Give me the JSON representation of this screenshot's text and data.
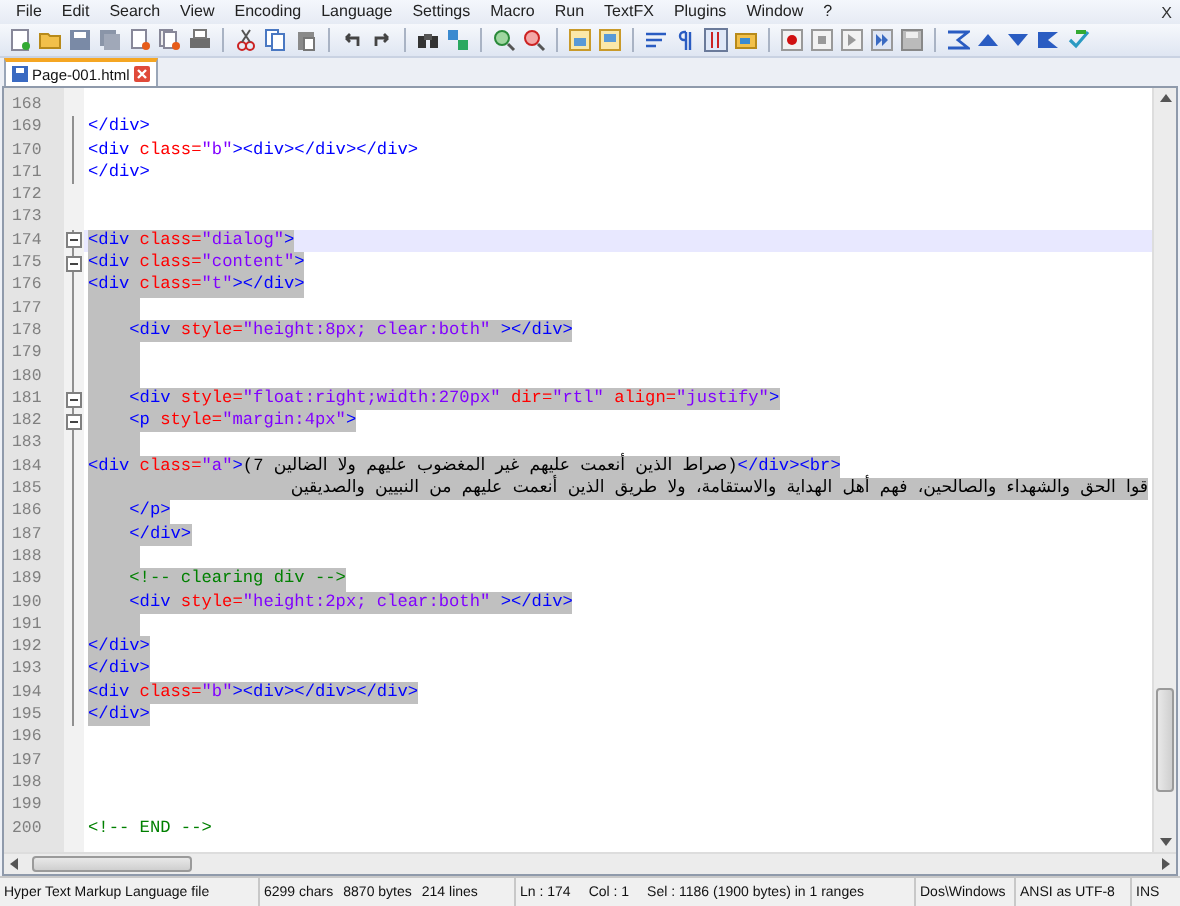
{
  "menu": [
    "File",
    "Edit",
    "Search",
    "View",
    "Encoding",
    "Language",
    "Settings",
    "Macro",
    "Run",
    "TextFX",
    "Plugins",
    "Window",
    "?"
  ],
  "window_close": "X",
  "tabs": [
    {
      "label": "Page-001.html",
      "selected": true
    }
  ],
  "lines": [
    {
      "number": "168",
      "kind": "code",
      "selected": false,
      "current": false,
      "fold_start": false,
      "in_fold": false
    },
    {
      "number": "169",
      "kind": "code",
      "selected": false,
      "current": false,
      "fold_start": false,
      "in_fold": true,
      "tokens": [
        {
          "kind": "tag",
          "text": "</div>"
        }
      ]
    },
    {
      "number": "170",
      "kind": "code",
      "selected": false,
      "current": false,
      "fold_start": false,
      "in_fold": true,
      "tokens": [
        {
          "kind": "tag",
          "text": "<div"
        },
        {
          "kind": "attr",
          "text": " class="
        },
        {
          "kind": "value",
          "text": "\"b\""
        },
        {
          "kind": "tag",
          "text": "><div></div></div>"
        }
      ]
    },
    {
      "number": "171",
      "kind": "code",
      "selected": false,
      "current": false,
      "fold_start": false,
      "in_fold": true,
      "tokens": [
        {
          "kind": "tag",
          "text": "</div>"
        }
      ]
    },
    {
      "number": "172",
      "kind": "code",
      "selected": false,
      "current": false,
      "fold_start": false,
      "in_fold": false
    },
    {
      "number": "173",
      "kind": "code",
      "selected": false,
      "current": false,
      "fold_start": false,
      "in_fold": false
    },
    {
      "number": "174",
      "kind": "code",
      "selected": true,
      "current": true,
      "fold_start": true,
      "in_fold": true,
      "tokens": [
        {
          "kind": "tag",
          "text": "<div"
        },
        {
          "kind": "attr",
          "text": " class="
        },
        {
          "kind": "value",
          "text": "\"dialog\""
        },
        {
          "kind": "tag",
          "text": ">"
        }
      ]
    },
    {
      "number": "175",
      "kind": "code",
      "selected": true,
      "current": false,
      "fold_start": true,
      "in_fold": true,
      "tokens": [
        {
          "kind": "tag",
          "text": "<div"
        },
        {
          "kind": "attr",
          "text": " class="
        },
        {
          "kind": "value",
          "text": "\"content\""
        },
        {
          "kind": "tag",
          "text": ">"
        }
      ]
    },
    {
      "number": "176",
      "kind": "code",
      "selected": true,
      "current": false,
      "fold_start": false,
      "in_fold": true,
      "tokens": [
        {
          "kind": "tag",
          "text": "<div"
        },
        {
          "kind": "attr",
          "text": " class="
        },
        {
          "kind": "value",
          "text": "\"t\""
        },
        {
          "kind": "tag",
          "text": "></div>"
        }
      ]
    },
    {
      "number": "177",
      "kind": "code",
      "selected": true,
      "current": false,
      "fold_start": false,
      "in_fold": true
    },
    {
      "number": "178",
      "kind": "code",
      "selected": true,
      "current": false,
      "fold_start": false,
      "in_fold": true,
      "tokens": [
        {
          "kind": "tag",
          "text": "    <div"
        },
        {
          "kind": "attr",
          "text": " style="
        },
        {
          "kind": "value",
          "text": "\"height:8px; clear:both\""
        },
        {
          "kind": "tag",
          "text": " ></div>"
        }
      ]
    },
    {
      "number": "179",
      "kind": "code",
      "selected": true,
      "current": false,
      "fold_start": false,
      "in_fold": true
    },
    {
      "number": "180",
      "kind": "code",
      "selected": true,
      "current": false,
      "fold_start": false,
      "in_fold": true
    },
    {
      "number": "181",
      "kind": "code",
      "selected": true,
      "current": false,
      "fold_start": true,
      "in_fold": true,
      "tokens": [
        {
          "kind": "tag",
          "text": "    <div"
        },
        {
          "kind": "attr",
          "text": " style="
        },
        {
          "kind": "value",
          "text": "\"float:right;width:270px\""
        },
        {
          "kind": "attr",
          "text": " dir="
        },
        {
          "kind": "value",
          "text": "\"rtl\""
        },
        {
          "kind": "attr",
          "text": " align="
        },
        {
          "kind": "value",
          "text": "\"justify\""
        },
        {
          "kind": "tag",
          "text": ">"
        }
      ]
    },
    {
      "number": "182",
      "kind": "code",
      "selected": true,
      "current": false,
      "fold_start": true,
      "in_fold": true,
      "tokens": [
        {
          "kind": "tag",
          "text": "    <p"
        },
        {
          "kind": "attr",
          "text": " style="
        },
        {
          "kind": "value",
          "text": "\"margin:4px\""
        },
        {
          "kind": "tag",
          "text": ">"
        }
      ]
    },
    {
      "number": "183",
      "kind": "code",
      "selected": true,
      "current": false,
      "fold_start": false,
      "in_fold": true
    },
    {
      "number": "184",
      "kind": "code",
      "selected": true,
      "current": false,
      "fold_start": false,
      "in_fold": true,
      "tokens": [
        {
          "kind": "tag",
          "text": "<div"
        },
        {
          "kind": "attr",
          "text": " class="
        },
        {
          "kind": "value",
          "text": "\"a\""
        },
        {
          "kind": "tag",
          "text": ">"
        },
        {
          "kind": "rtl",
          "text": "(صراط الذين أنعمت عليهم غير المغضوب عليهم ولا الضالين 7)"
        },
        {
          "kind": "tag",
          "text": "</div><br>"
        }
      ]
    },
    {
      "number": "185",
      "kind": "rtl",
      "selected": true,
      "current": false,
      "fold_start": false,
      "in_fold": true,
      "tokens": [
        {
          "kind": "rtl",
          "text": "قوا الحق والشهداء والصالحين، فهم أهل الهداية والاستقامة، ولا طريق الذين أنعمت عليهم من النبيين والصديقين"
        }
      ]
    },
    {
      "number": "186",
      "kind": "code",
      "selected": true,
      "current": false,
      "fold_start": false,
      "in_fold": true,
      "tokens": [
        {
          "kind": "tag",
          "text": "    </p>"
        }
      ]
    },
    {
      "number": "187",
      "kind": "code",
      "selected": true,
      "current": false,
      "fold_start": false,
      "in_fold": true,
      "tokens": [
        {
          "kind": "tag",
          "text": "    </div>"
        }
      ]
    },
    {
      "number": "188",
      "kind": "code",
      "selected": true,
      "current": false,
      "fold_start": false,
      "in_fold": true
    },
    {
      "number": "189",
      "kind": "code",
      "selected": true,
      "current": false,
      "fold_start": false,
      "in_fold": true,
      "tokens": [
        {
          "kind": "comment",
          "text": "    <!-- clearing div -->"
        }
      ]
    },
    {
      "number": "190",
      "kind": "code",
      "selected": true,
      "current": false,
      "fold_start": false,
      "in_fold": true,
      "tokens": [
        {
          "kind": "tag",
          "text": "    <div"
        },
        {
          "kind": "attr",
          "text": " style="
        },
        {
          "kind": "value",
          "text": "\"height:2px; clear:both\""
        },
        {
          "kind": "tag",
          "text": " ></div>"
        }
      ]
    },
    {
      "number": "191",
      "kind": "code",
      "selected": true,
      "current": false,
      "fold_start": false,
      "in_fold": true
    },
    {
      "number": "192",
      "kind": "code",
      "selected": true,
      "current": false,
      "fold_start": false,
      "in_fold": true,
      "tokens": [
        {
          "kind": "tag",
          "text": "</div>"
        }
      ]
    },
    {
      "number": "193",
      "kind": "code",
      "selected": true,
      "current": false,
      "fold_start": false,
      "in_fold": true,
      "tokens": [
        {
          "kind": "tag",
          "text": "</div>"
        }
      ]
    },
    {
      "number": "194",
      "kind": "code",
      "selected": true,
      "current": false,
      "fold_start": false,
      "in_fold": true,
      "tokens": [
        {
          "kind": "tag",
          "text": "<div"
        },
        {
          "kind": "attr",
          "text": " class="
        },
        {
          "kind": "value",
          "text": "\"b\""
        },
        {
          "kind": "tag",
          "text": "><div></div></div>"
        }
      ]
    },
    {
      "number": "195",
      "kind": "code",
      "selected": true,
      "current": false,
      "fold_start": false,
      "in_fold": true,
      "tokens": [
        {
          "kind": "tag",
          "text": "</div>"
        }
      ]
    },
    {
      "number": "196",
      "kind": "code",
      "selected": false,
      "current": false,
      "fold_start": false,
      "in_fold": false
    },
    {
      "number": "197",
      "kind": "code",
      "selected": false,
      "current": false,
      "fold_start": false,
      "in_fold": false
    },
    {
      "number": "198",
      "kind": "code",
      "selected": false,
      "current": false,
      "fold_start": false,
      "in_fold": false
    },
    {
      "number": "199",
      "kind": "code",
      "selected": false,
      "current": false,
      "fold_start": false,
      "in_fold": false
    },
    {
      "number": "200",
      "kind": "code",
      "selected": false,
      "current": false,
      "fold_start": false,
      "in_fold": false,
      "tokens": [
        {
          "kind": "comment",
          "text": "<!-- END -->"
        }
      ]
    }
  ],
  "status_bar": {
    "file_type": "Hyper Text Markup Language file",
    "chars": "6299 chars",
    "bytes": "8870 bytes",
    "lines": "214 lines",
    "line": "Ln : 174",
    "column": "Col : 1",
    "selection": "Sel : 1186 (1900 bytes) in 1 ranges",
    "eol": "Dos\\Windows",
    "encoding": "ANSI as UTF-8",
    "mode": "INS"
  }
}
